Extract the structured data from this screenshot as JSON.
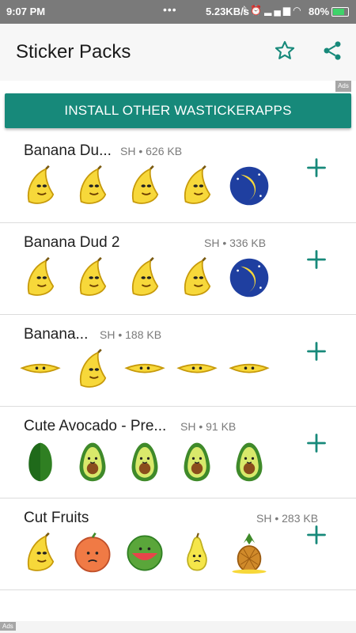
{
  "status_bar": {
    "time": "9:07 PM",
    "dots": "•••",
    "speed": "5.23KB/s",
    "icons": [
      "bluetooth-icon",
      "alarm-icon",
      "signal-icon",
      "signal-icon",
      "wifi-icon"
    ],
    "battery": "80%",
    "battery_level": 0.8
  },
  "app_bar": {
    "title": "Sticker Packs",
    "actions": [
      "star-icon",
      "share-icon"
    ]
  },
  "ad_label": "Ads",
  "install_button": "INSTALL OTHER WASTICKERAPPS",
  "packs": [
    {
      "name": "Banana Du...",
      "meta": "SH • 626 KB",
      "stickers": [
        "banana-smirk-sticker",
        "banana-peel-sticker",
        "banana-shirt-sticker",
        "banana-superhero-sticker",
        "banana-beach-sticker"
      ]
    },
    {
      "name": "Banana Dud 2",
      "meta": "SH • 336 KB",
      "stickers": [
        "banana-slice-sticker",
        "banana-bandage-sticker",
        "banana-surf-sticker",
        "banana-sad-sticker",
        "banana-moon-sticker"
      ]
    },
    {
      "name": "Banana...",
      "meta": "SH • 188 KB",
      "stickers": [
        "banana-sad-lying-sticker",
        "banana-sunglasses-sticker",
        "banana-sunbath-sticker",
        "banana-donkey-sticker",
        "banana-happy-sticker"
      ]
    },
    {
      "name": "Cute Avocado - Pre...",
      "meta": "SH • 91 KB",
      "stickers": [
        "avocado-sliced-sticker",
        "avocado-happy-sticker",
        "avocado-smile-sticker",
        "avocado-hat-sticker",
        "avocado-cute-sticker"
      ]
    },
    {
      "name": "Cut Fruits",
      "meta": "SH • 283 KB",
      "stickers": [
        "banana-bunch-sticker",
        "orange-sad-sticker",
        "watermelon-sticker",
        "pear-sticker",
        "pineapple-sticker"
      ]
    }
  ],
  "bottom_ad": "Ads",
  "colors": {
    "accent": "#17897a",
    "status_bar": "#7a7a7a",
    "app_bar": "#f7f7f7"
  }
}
